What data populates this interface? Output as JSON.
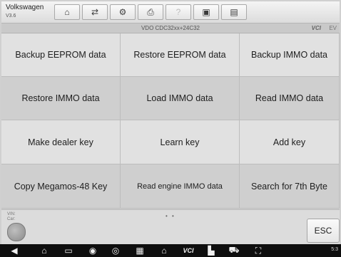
{
  "header": {
    "make": "Volkswagen",
    "version": "V3.6",
    "tools": [
      {
        "icon": "home-icon",
        "glyph": "⌂"
      },
      {
        "icon": "vehicle-swap-icon",
        "glyph": "⇄"
      },
      {
        "icon": "settings-icon",
        "glyph": "⚙"
      },
      {
        "icon": "print-icon",
        "glyph": "⎙"
      },
      {
        "icon": "help-icon",
        "glyph": "?"
      },
      {
        "icon": "save-icon",
        "glyph": "▣"
      },
      {
        "icon": "data-logging-icon",
        "glyph": "▤"
      }
    ]
  },
  "subheader": {
    "title": "VDO CDC32xx+24C32",
    "vci": "VCI",
    "battery": "EV"
  },
  "functions": [
    {
      "label": "Backup EEPROM data"
    },
    {
      "label": "Restore EEPROM data"
    },
    {
      "label": "Backup IMMO data"
    },
    {
      "label": "Restore IMMO data"
    },
    {
      "label": "Load IMMO data"
    },
    {
      "label": "Read IMMO data"
    },
    {
      "label": "Make dealer key"
    },
    {
      "label": "Learn key"
    },
    {
      "label": "Add key"
    },
    {
      "label": "Copy Megamos-48 Key"
    },
    {
      "label": "Read engine IMMO data"
    },
    {
      "label": "Search for 7th Byte"
    }
  ],
  "footer": {
    "vin_label": "VIN:",
    "car_label": "Car:",
    "page_dots": "• •",
    "esc_label": "ESC"
  },
  "navbar": {
    "items": [
      {
        "icon": "back-icon",
        "glyph": "◀"
      },
      {
        "icon": "android-home-icon",
        "glyph": "⌂"
      },
      {
        "icon": "recent-apps-icon",
        "glyph": "▭"
      },
      {
        "icon": "browser-icon",
        "glyph": "◉"
      },
      {
        "icon": "camera-icon",
        "glyph": "◎"
      },
      {
        "icon": "display-icon",
        "glyph": "▦"
      },
      {
        "icon": "maxisys-home-icon",
        "glyph": "⌂"
      },
      {
        "icon": "vci-icon",
        "glyph": "VCI"
      },
      {
        "icon": "shop-icon",
        "glyph": "▙"
      },
      {
        "icon": "car-icon",
        "glyph": "⛟"
      },
      {
        "icon": "remote-icon",
        "glyph": "⛶"
      }
    ],
    "status_text": "5:3"
  },
  "colors": {
    "cell_light": "#e1e1e1",
    "cell_dark": "#cfcfcf",
    "navbar_bg": "#0e0e0e"
  }
}
